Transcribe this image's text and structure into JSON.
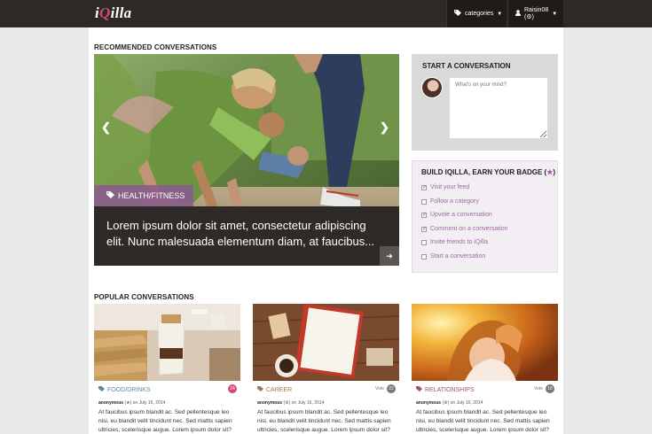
{
  "header": {
    "logo_i": "i",
    "logo_q": "Q",
    "logo_rest": "illa",
    "categories_label": "categories",
    "user_label": "Raisin08 (",
    "user_badge": "⚙",
    "user_label_end": ")"
  },
  "recommended": {
    "heading": "RECOMMENDED CONVERSATIONS",
    "tag": "HEALTH/FITNESS",
    "tag_icon": "tag-icon",
    "title": "Lorem ipsum dolor sit amet, consectetur adipiscing elit. Nunc malesuada elementum diam, at faucibus...",
    "prev_arrow": "❮",
    "next_arrow": "❯",
    "more_icon": "➜"
  },
  "start": {
    "heading": "START A CONVERSATION",
    "placeholder": "What's on your mind?"
  },
  "badge": {
    "heading": "BUILD IQILLA, EARN YOUR BADGE (",
    "star": "★",
    "heading_end": ")",
    "tasks": [
      {
        "label": "Visit your feed",
        "checked": true
      },
      {
        "label": "Follow a category",
        "checked": false
      },
      {
        "label": "Upvote a conversation",
        "checked": true
      },
      {
        "label": "Comment on a conversation",
        "checked": true
      },
      {
        "label": "Invite friends to iQilla",
        "checked": false
      },
      {
        "label": "Start a conversation",
        "checked": false
      }
    ]
  },
  "popular": {
    "heading": "POPULAR CONVERSATIONS",
    "cards": [
      {
        "category": "FOOD/DRINKS",
        "category_color": "#5b8a9a",
        "vote_label": "",
        "votes": "24",
        "vote_color": "#d9477a",
        "author": "anonymous",
        "author_badge": "(★)",
        "date": "on July 16, 2014",
        "excerpt": "At faucibus ipsum blandit ac. Sed pellentesque leo nisi, eu blandit velit tincidunt nec. Sed mattis sapien ultricies, scelerisque augue. Lorem ipsum dolor sit?"
      },
      {
        "category": "CAREER",
        "category_color": "#a07a52",
        "vote_label": "Vote",
        "votes": "22",
        "vote_color": "#777777",
        "author": "anonymous",
        "author_badge": "(⚙)",
        "date": "on July 16, 2014",
        "excerpt": "At faucibus ipsum blandit ac. Sed pellentesque leo nisi, eu blandit velit tincidunt nec. Sed mattis sapien ultricies, scelerisque augue. Lorem ipsum dolor sit?"
      },
      {
        "category": "RELATIONSHIPS",
        "category_color": "#a0507a",
        "vote_label": "Vote",
        "votes": "18",
        "vote_color": "#777777",
        "author": "anonymous",
        "author_badge": "(⚙)",
        "date": "on July 16, 2014",
        "excerpt": "At faucibus ipsum blandit ac. Sed pellentesque leo nisi, eu blandit velit tincidunt nec. Sed mattis sapien ultricies, scelerisque augue. Lorem ipsum dolor sit?"
      }
    ]
  }
}
